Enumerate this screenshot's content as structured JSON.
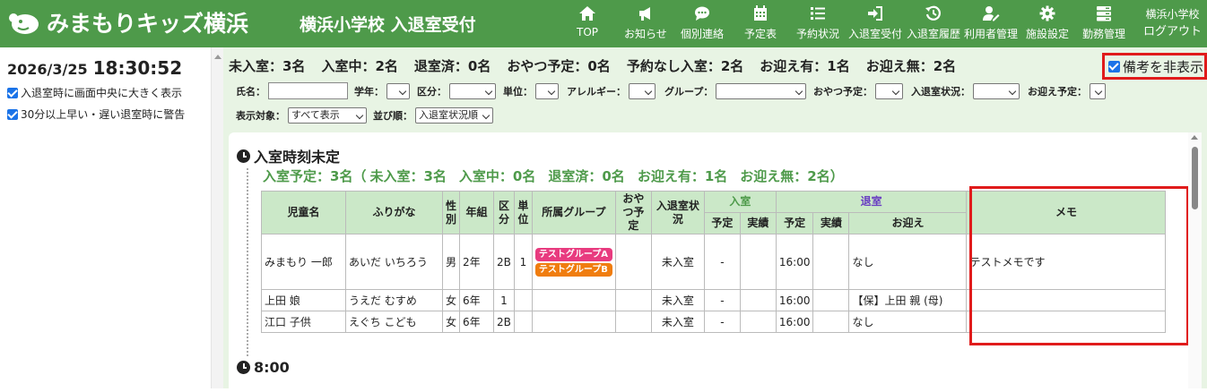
{
  "header": {
    "logo_text": "みまもりキッズ横浜",
    "school_title": "横浜小学校 入退室受付",
    "nav": [
      {
        "label": "TOP",
        "icon": "home-icon"
      },
      {
        "label": "お知らせ",
        "icon": "megaphone-icon"
      },
      {
        "label": "個別連絡",
        "icon": "chat-icon"
      },
      {
        "label": "予定表",
        "icon": "calendar-icon"
      },
      {
        "label": "予約状況",
        "icon": "list-icon"
      },
      {
        "label": "入退室受付",
        "icon": "sign-in-icon"
      },
      {
        "label": "入退室履歴",
        "icon": "history-icon"
      },
      {
        "label": "利用者管理",
        "icon": "user-edit-icon"
      },
      {
        "label": "施設設定",
        "icon": "gear-icon"
      },
      {
        "label": "勤務管理",
        "icon": "server-icon"
      }
    ],
    "account_name": "横浜小学校",
    "logout": "ログアウト"
  },
  "left": {
    "date": "2026/3/25",
    "time": "18:30:52",
    "option1": "入退室時に画面中央に大きく表示",
    "option2": "30分以上早い・遅い退室時に警告"
  },
  "summary": {
    "not_entered": "未入室：3名",
    "in_room": "入室中：2名",
    "left_room": "退室済：0名",
    "snack": "おやつ予定：0名",
    "no_reservation": "予約なし入室：2名",
    "pickup_yes": "お迎え有：1名",
    "pickup_no": "お迎え無：2名",
    "hide_remarks": "備考を非表示"
  },
  "filters": {
    "name": "氏名：",
    "grade": "学年：",
    "division": "区分：",
    "unit": "単位：",
    "allergy": "アレルギー：",
    "group": "グループ：",
    "snack": "おやつ予定：",
    "status": "入退室状況：",
    "pickup": "お迎え予定：",
    "display_target": "表示対象：",
    "display_target_value": "すべて表示",
    "sort": "並び順：",
    "sort_value": "入退室状況順"
  },
  "section1": {
    "title": "入室時刻未定",
    "summary": {
      "planned": "入室予定：3名（",
      "not_entered": "未入室：3名",
      "in_room": "入室中：0名",
      "left_room": "退室済：0名",
      "pickup_yes": "お迎え有：1名",
      "pickup_no": "お迎え無：2名）"
    }
  },
  "section2": {
    "title": "8:00"
  },
  "table": {
    "headers": {
      "name": "児童名",
      "furigana": "ふりがな",
      "sex": "性別",
      "grade_class": "年組",
      "division": "区分",
      "unit": "単位",
      "group": "所属グループ",
      "snack": "おやつ予定",
      "status": "入退室状況",
      "entry": "入室",
      "exit": "退室",
      "memo": "メモ",
      "entry_plan": "予定",
      "entry_actual": "実績",
      "exit_plan": "予定",
      "exit_actual": "実績",
      "pickup": "お迎え"
    },
    "rows": [
      {
        "name": "みまもり 一郎",
        "furigana": "あいだ いちろう",
        "sex": "男",
        "grade": "2年",
        "division": "2B",
        "unit": "1",
        "groups": [
          "テストグループA",
          "テストグループB"
        ],
        "snack": "",
        "status": "未入室",
        "entry_plan": "-",
        "entry_actual": "",
        "exit_plan": "16:00",
        "exit_actual": "",
        "pickup": "なし",
        "memo": "テストメモです"
      },
      {
        "name": "上田 娘",
        "furigana": "うえだ むすめ",
        "sex": "女",
        "grade": "6年",
        "division": "1",
        "unit": "",
        "groups": [],
        "snack": "",
        "status": "未入室",
        "entry_plan": "-",
        "entry_actual": "",
        "exit_plan": "16:00",
        "exit_actual": "",
        "pickup": "【保】上田 親 (母)",
        "memo": ""
      },
      {
        "name": "江口 子供",
        "furigana": "えぐち こども",
        "sex": "女",
        "grade": "6年",
        "division": "2B",
        "unit": "",
        "groups": [],
        "snack": "",
        "status": "未入室",
        "entry_plan": "-",
        "entry_actual": "",
        "exit_plan": "16:00",
        "exit_actual": "",
        "pickup": "なし",
        "memo": ""
      }
    ]
  },
  "colors": {
    "header_green": "#4e9a4a",
    "filter_bg": "#e8f4e4",
    "table_header": "#cbe8c8",
    "highlight_red": "#e01b1b",
    "tag_a": "#e83b7f",
    "tag_b": "#f07d0f"
  }
}
